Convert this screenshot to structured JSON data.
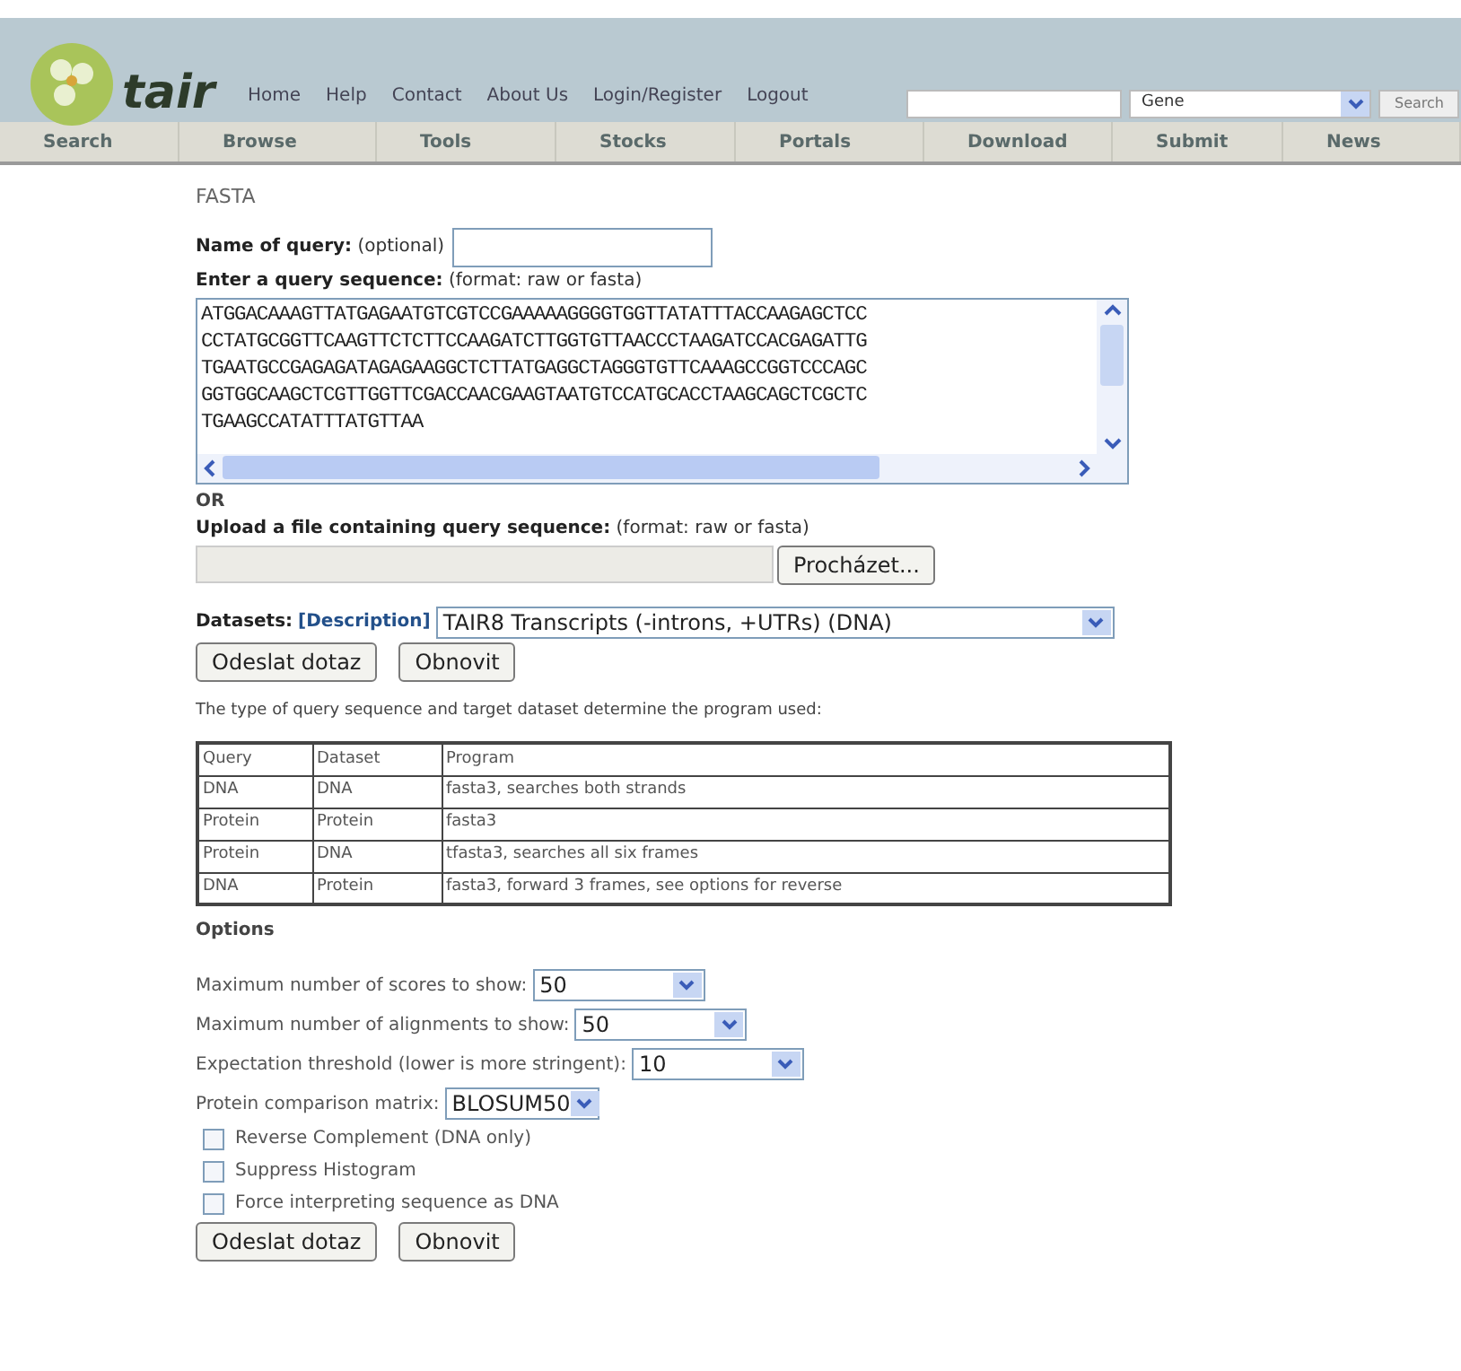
{
  "header": {
    "logo": "tair",
    "links": [
      "Home",
      "Help",
      "Contact",
      "About Us",
      "Login/Register",
      "Logout"
    ],
    "search_type": "Gene",
    "search_button": "Search"
  },
  "nav": [
    "Search",
    "Browse",
    "Tools",
    "Stocks",
    "Portals",
    "Download",
    "Submit",
    "News"
  ],
  "page_title": "FASTA",
  "query_name": {
    "label": "Name of query:",
    "hint": "(optional)"
  },
  "sequence": {
    "label": "Enter a query sequence:",
    "hint": "(format: raw or fasta)",
    "lines": [
      "ATGGACAAAGTTATGAGAATGTCGTCCGAAAAAGGGGTGGTTATATTTACCAAGAGCTCC",
      "CCTATGCGGTTCAAGTTCTCTTCCAAGATCTTGGTGTTAACCCTAAGATCCACGAGATTG",
      "TGAATGCCGAGAGATAGAGAAGGCTCTTATGAGGCTAGGGTGTTCAAAGCCGGTCCCAGC",
      "GGTGGCAAGCTCGTTGGTTCGACCAACGAAGTAATGTCCATGCACCTAAGCAGCTCGCTC",
      "TGAAGCCATATTTATGTTAA"
    ]
  },
  "or_label": "OR",
  "upload": {
    "label": "Upload a file containing query sequence:",
    "hint": "(format: raw or fasta)",
    "browse_button": "Procházet..."
  },
  "datasets": {
    "label": "Datasets:",
    "link": "[Description]",
    "value": "TAIR8 Transcripts (-introns, +UTRs) (DNA)"
  },
  "buttons_top": [
    "Odeslat dotaz",
    "Obnovit"
  ],
  "table_intro": "The type of query sequence and target dataset determine the program used:",
  "table": {
    "columns": [
      "Query",
      "Dataset",
      "Program"
    ],
    "rows": [
      [
        "DNA",
        "DNA",
        "fasta3, searches both strands"
      ],
      [
        "Protein",
        "Protein",
        "fasta3"
      ],
      [
        "Protein",
        "DNA",
        "tfasta3, searches all six frames"
      ],
      [
        "DNA",
        "Protein",
        "fasta3, forward 3 frames, see options for reverse"
      ]
    ]
  },
  "options_title": "Options",
  "selects": [
    {
      "label": "Maximum number of scores to show:",
      "value": "50"
    },
    {
      "label": "Maximum number of alignments to show:",
      "value": "50"
    },
    {
      "label": "Expectation threshold (lower is more stringent):",
      "value": "10"
    },
    {
      "label": "Protein comparison matrix:",
      "value": "BLOSUM50"
    }
  ],
  "checkboxes": [
    {
      "label": "Reverse Complement (DNA only)",
      "checked": false
    },
    {
      "label": "Suppress Histogram",
      "checked": false
    },
    {
      "label": "Force interpreting sequence as DNA",
      "checked": false
    }
  ],
  "buttons_bottom": [
    "Odeslat dotaz",
    "Obnovit"
  ]
}
